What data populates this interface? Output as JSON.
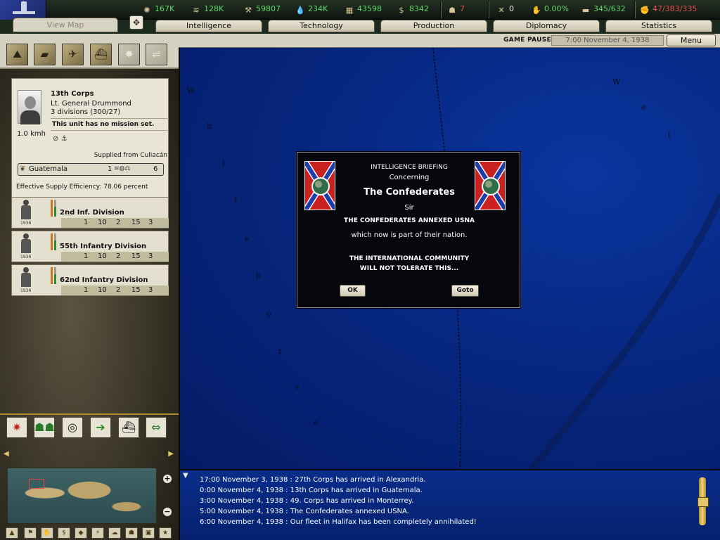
{
  "resources": [
    {
      "icon": "energy-icon",
      "glyph": "✺",
      "value": "167K",
      "color": "#5ed86b"
    },
    {
      "icon": "metal-icon",
      "glyph": "≋",
      "value": "128K",
      "color": "#5ed86b"
    },
    {
      "icon": "rare-materials-icon",
      "glyph": "⚒",
      "value": "59807",
      "color": "#5ed86b"
    },
    {
      "icon": "oil-icon",
      "glyph": "💧",
      "value": "234K",
      "color": "#5ed86b"
    },
    {
      "icon": "supplies-icon",
      "glyph": "▦",
      "value": "43598",
      "color": "#5ed86b"
    },
    {
      "icon": "money-icon",
      "glyph": "$",
      "value": "8342",
      "color": "#5ed86b"
    },
    {
      "icon": "manpower-icon",
      "glyph": "☗",
      "value": "7",
      "color": "#e05050"
    },
    {
      "icon": "transports-icon",
      "glyph": "✕",
      "value": "0",
      "color": "#e8e8e8"
    },
    {
      "icon": "dissent-icon",
      "glyph": "✋",
      "value": "0.00%",
      "color": "#5ed86b"
    },
    {
      "icon": "convoys-icon",
      "glyph": "▬",
      "value": "345/632",
      "color": "#5ed86b"
    },
    {
      "icon": "ic-icon",
      "glyph": "✊",
      "value": "47/383/335",
      "color": "#e05050"
    }
  ],
  "tabs": [
    {
      "label": "View Map",
      "active": true
    },
    {
      "label": "Intelligence"
    },
    {
      "label": "Technology"
    },
    {
      "label": "Production"
    },
    {
      "label": "Diplomacy"
    },
    {
      "label": "Statistics"
    }
  ],
  "status": {
    "paused": "GAME PAUSED",
    "date": "7:00 November 4, 1938",
    "menu": "Menu"
  },
  "unit": {
    "name": "13th Corps",
    "general": "Lt. General Drummond",
    "divisions": "3 divisions (300/27)",
    "speed": "1.0 kmh",
    "mission": "This unit has no mission set.",
    "supplied_from": "Supplied from Culiacán",
    "location": {
      "name": "Guatemala",
      "num1": "1",
      "num2": "6"
    },
    "supply_efficiency": "Effective Supply Efficiency: 78.06 percent"
  },
  "division_cards": [
    {
      "name": "2nd Inf. Division",
      "year": "1936",
      "stats": [
        "1",
        "10",
        "2",
        "15",
        "3"
      ]
    },
    {
      "name": "55th Infantry Division",
      "year": "1936",
      "stats": [
        "1",
        "10",
        "2",
        "15",
        "3"
      ]
    },
    {
      "name": "62nd Infantry Division",
      "year": "1936",
      "stats": [
        "1",
        "10",
        "2",
        "15",
        "3"
      ]
    }
  ],
  "map_labels": [
    "W",
    "h",
    "i",
    "t",
    "e",
    "h",
    "o",
    "r",
    "s",
    "e",
    "W",
    "e",
    "l"
  ],
  "dialog": {
    "header": "INTELLIGENCE BRIEFING",
    "concerning": "Concerning",
    "nation": "The Confederates",
    "salutation": "Sir",
    "line1": "THE CONFEDERATES ANNEXED USNA",
    "line2": "which now is part of their nation.",
    "line3": "THE INTERNATIONAL COMMUNITY WILL NOT TOLERATE THIS...",
    "ok": "OK",
    "goto": "Goto"
  },
  "log": [
    "17:00 November 3, 1938 : 27th Corps has arrived in Alexandria.",
    "0:00 November 4, 1938 : 13th Corps has arrived in Guatemala.",
    "3:00 November 4, 1938 : 49. Corps has arrived in Monterrey.",
    "5:00 November 4, 1938 : The Confederates annexed USNA.",
    "6:00 November 4, 1938 : Our fleet in Halifax has been completely annihilated!"
  ],
  "colors": {
    "map_ocean": "#06247a",
    "resource_ok": "#5ed86b",
    "resource_bad": "#e05050",
    "accent_gold": "#b08a2a"
  }
}
